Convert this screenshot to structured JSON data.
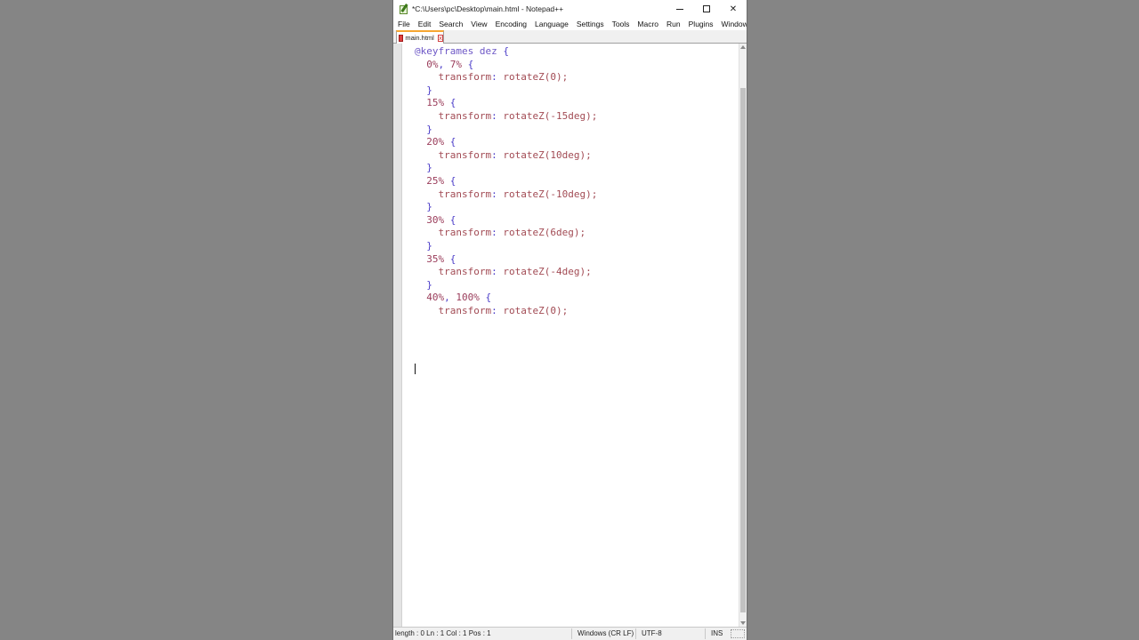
{
  "window": {
    "title": "*C:\\Users\\pc\\Desktop\\main.html - Notepad++",
    "controls": {
      "minimize": "–",
      "maximize": "□",
      "close": "✕"
    }
  },
  "menu": [
    "File",
    "Edit",
    "Search",
    "View",
    "Encoding",
    "Language",
    "Settings",
    "Tools",
    "Macro",
    "Run",
    "Plugins",
    "Window"
  ],
  "tab": {
    "label": "main.html",
    "close_glyph": "x"
  },
  "code_lines": [
    {
      "indent": "",
      "tokens": [
        {
          "t": "@keyframes",
          "c": "at"
        },
        {
          "t": " dez ",
          "c": "sel"
        },
        {
          "t": "{",
          "c": "punc"
        }
      ]
    },
    {
      "indent": "  ",
      "tokens": [
        {
          "t": "0%",
          "c": "num"
        },
        {
          "t": ", ",
          "c": "punc"
        },
        {
          "t": "7%",
          "c": "num"
        },
        {
          "t": " {",
          "c": "punc"
        }
      ]
    },
    {
      "indent": "    ",
      "tokens": [
        {
          "t": "transform",
          "c": "prop"
        },
        {
          "t": ": ",
          "c": "punc"
        },
        {
          "t": "rotateZ(0);",
          "c": "val"
        }
      ]
    },
    {
      "indent": "  ",
      "tokens": [
        {
          "t": "}",
          "c": "punc"
        }
      ]
    },
    {
      "indent": "  ",
      "tokens": [
        {
          "t": "15%",
          "c": "num"
        },
        {
          "t": " {",
          "c": "punc"
        }
      ]
    },
    {
      "indent": "    ",
      "tokens": [
        {
          "t": "transform",
          "c": "prop"
        },
        {
          "t": ": ",
          "c": "punc"
        },
        {
          "t": "rotateZ(-15deg);",
          "c": "val"
        }
      ]
    },
    {
      "indent": "  ",
      "tokens": [
        {
          "t": "}",
          "c": "punc"
        }
      ]
    },
    {
      "indent": "  ",
      "tokens": [
        {
          "t": "20%",
          "c": "num"
        },
        {
          "t": " {",
          "c": "punc"
        }
      ]
    },
    {
      "indent": "    ",
      "tokens": [
        {
          "t": "transform",
          "c": "prop"
        },
        {
          "t": ": ",
          "c": "punc"
        },
        {
          "t": "rotateZ(10deg);",
          "c": "val"
        }
      ]
    },
    {
      "indent": "  ",
      "tokens": [
        {
          "t": "}",
          "c": "punc"
        }
      ]
    },
    {
      "indent": "  ",
      "tokens": [
        {
          "t": "25%",
          "c": "num"
        },
        {
          "t": " {",
          "c": "punc"
        }
      ]
    },
    {
      "indent": "    ",
      "tokens": [
        {
          "t": "transform",
          "c": "prop"
        },
        {
          "t": ": ",
          "c": "punc"
        },
        {
          "t": "rotateZ(-10deg);",
          "c": "val"
        }
      ]
    },
    {
      "indent": "  ",
      "tokens": [
        {
          "t": "}",
          "c": "punc"
        }
      ]
    },
    {
      "indent": "  ",
      "tokens": [
        {
          "t": "30%",
          "c": "num"
        },
        {
          "t": " {",
          "c": "punc"
        }
      ]
    },
    {
      "indent": "    ",
      "tokens": [
        {
          "t": "transform",
          "c": "prop"
        },
        {
          "t": ": ",
          "c": "punc"
        },
        {
          "t": "rotateZ(6deg);",
          "c": "val"
        }
      ]
    },
    {
      "indent": "  ",
      "tokens": [
        {
          "t": "}",
          "c": "punc"
        }
      ]
    },
    {
      "indent": "  ",
      "tokens": [
        {
          "t": "35%",
          "c": "num"
        },
        {
          "t": " {",
          "c": "punc"
        }
      ]
    },
    {
      "indent": "    ",
      "tokens": [
        {
          "t": "transform",
          "c": "prop"
        },
        {
          "t": ": ",
          "c": "punc"
        },
        {
          "t": "rotateZ(-4deg);",
          "c": "val"
        }
      ]
    },
    {
      "indent": "  ",
      "tokens": [
        {
          "t": "}",
          "c": "punc"
        }
      ]
    },
    {
      "indent": "  ",
      "tokens": [
        {
          "t": "40%",
          "c": "num"
        },
        {
          "t": ", ",
          "c": "punc"
        },
        {
          "t": "100%",
          "c": "num"
        },
        {
          "t": " {",
          "c": "punc"
        }
      ]
    },
    {
      "indent": "    ",
      "tokens": [
        {
          "t": "transform",
          "c": "prop"
        },
        {
          "t": ": ",
          "c": "punc"
        },
        {
          "t": "rotateZ(0);",
          "c": "val"
        }
      ]
    }
  ],
  "status": {
    "length": "length : 0   Ln : 1    Col : 1    Pos : 1",
    "eol": "Windows (CR LF)",
    "encoding": "UTF-8",
    "mode": "INS"
  },
  "colors": {
    "background": "#858585",
    "tab_accent": "#f6a632",
    "keyword": "#6d57c6",
    "number": "#9a3c5a",
    "property": "#a24b54",
    "punctuation": "#4a3cc8"
  },
  "icons": {
    "app": "notepadpp-icon",
    "tab_file": "file-modified-icon",
    "tab_close": "close-icon",
    "grip": "resize-grip-icon"
  }
}
